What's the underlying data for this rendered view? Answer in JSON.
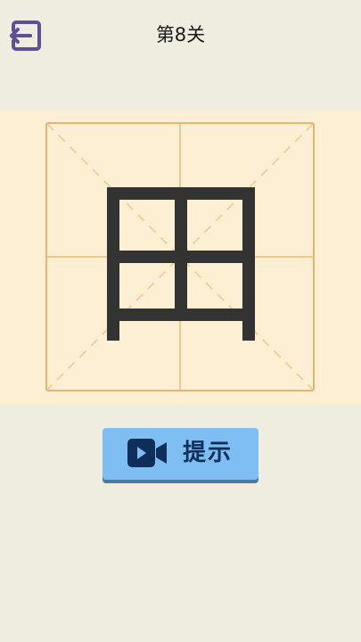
{
  "header": {
    "title": "第8关",
    "back_icon": "exit-icon"
  },
  "puzzle": {
    "character": "田"
  },
  "hint_button": {
    "label": "提示",
    "icon": "video-camera-icon"
  },
  "colors": {
    "background": "#efece0",
    "board": "#fdefd3",
    "grid_line": "#e6b46f",
    "glyph": "#333333",
    "hint_button": "#7ebef2",
    "hint_text": "#0f2f5a",
    "back_icon": "#5f4f99"
  }
}
